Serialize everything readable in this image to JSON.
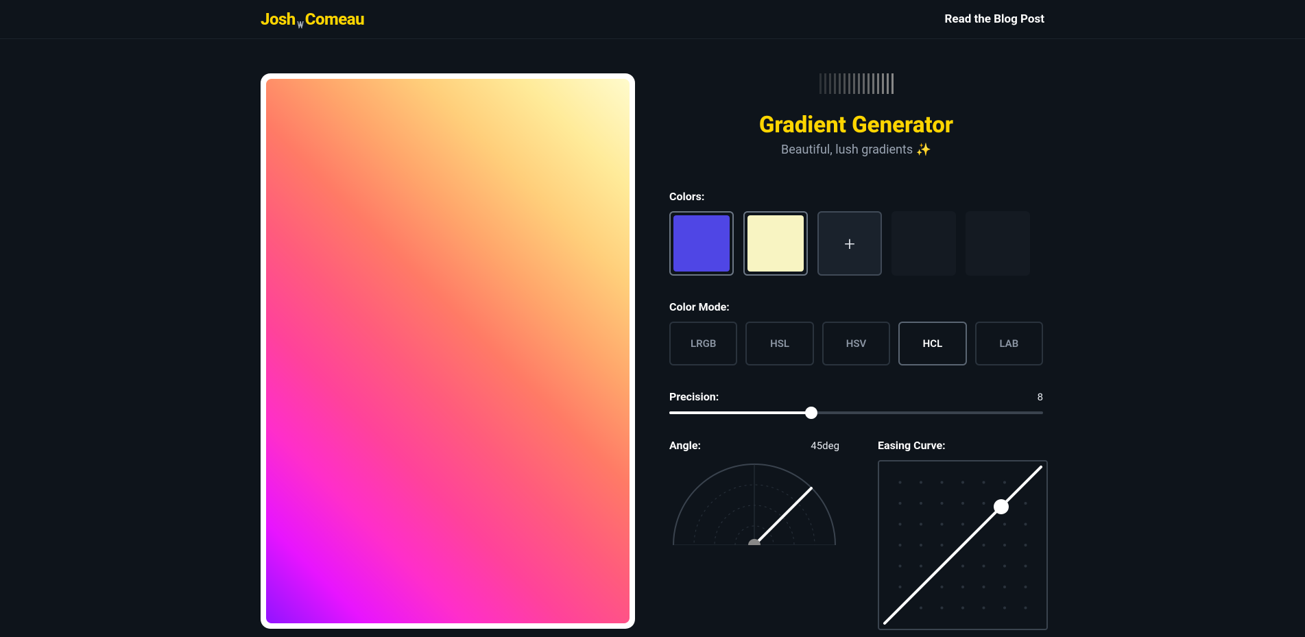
{
  "header": {
    "logo_part1": "Josh",
    "logo_w": "W",
    "logo_part2": "Comeau",
    "blog_link": "Read the Blog Post"
  },
  "title": {
    "heading": "Gradient Generator",
    "sub": "Beautiful, lush gradients ✨"
  },
  "colors": {
    "label": "Colors:",
    "swatches": [
      "#4F46E5",
      "#F8F4C2"
    ],
    "add_symbol": "+"
  },
  "modes": {
    "label": "Color Mode:",
    "options": [
      "LRGB",
      "HSL",
      "HSV",
      "HCL",
      "LAB"
    ],
    "active": "HCL"
  },
  "precision": {
    "label": "Precision:",
    "value": "8",
    "percent": 38
  },
  "angle": {
    "label": "Angle:",
    "value": "45deg"
  },
  "easing": {
    "label": "Easing Curve:"
  }
}
